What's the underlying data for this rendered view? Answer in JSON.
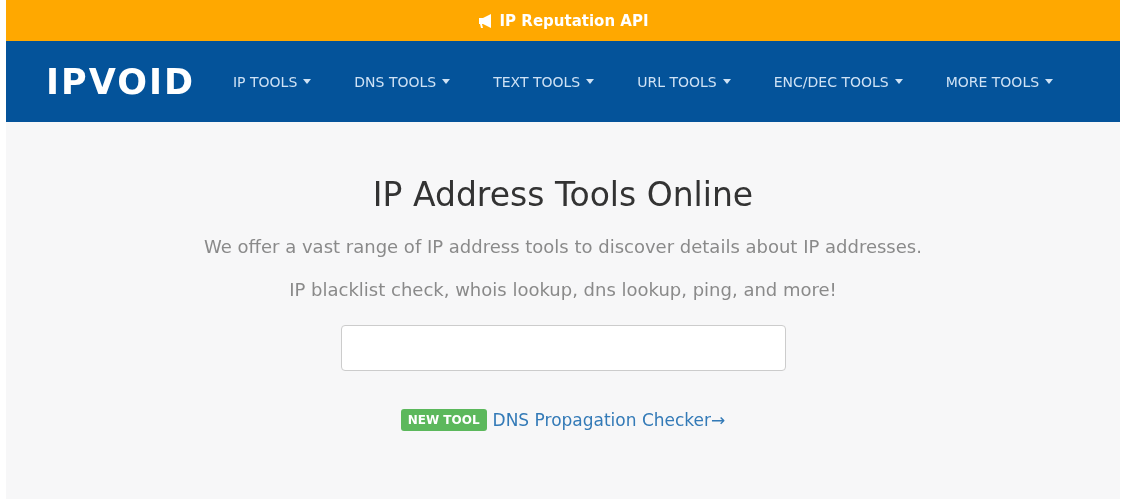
{
  "banner": {
    "text": "IP Reputation API"
  },
  "brand": "IPVOID",
  "nav": [
    {
      "label": "IP TOOLS"
    },
    {
      "label": "DNS TOOLS"
    },
    {
      "label": "TEXT TOOLS"
    },
    {
      "label": "URL TOOLS"
    },
    {
      "label": "ENC/DEC TOOLS"
    },
    {
      "label": "MORE TOOLS"
    }
  ],
  "hero": {
    "title": "IP Address Tools Online",
    "subtitle": "We offer a vast range of IP address tools to discover details about IP addresses.",
    "tagline": "IP blacklist check, whois lookup, dns lookup, ping, and more!"
  },
  "promo": {
    "badge": "NEW TOOL",
    "link": "DNS Propagation Checker→"
  }
}
